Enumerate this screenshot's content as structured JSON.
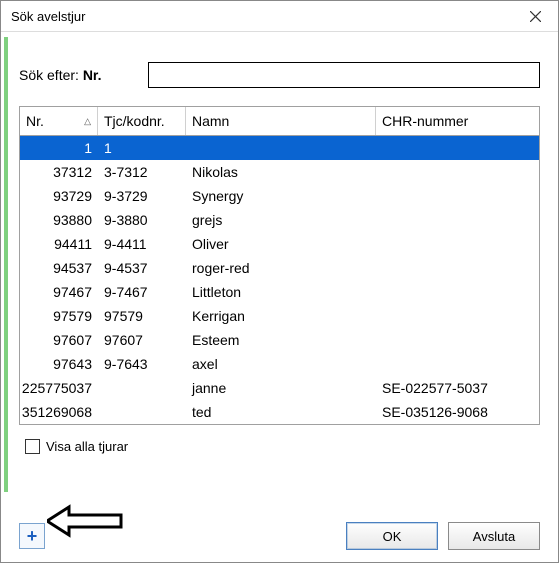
{
  "window": {
    "title": "Sök avelstjur"
  },
  "search": {
    "label_prefix": "Sök efter:",
    "label_field": "Nr.",
    "value": "",
    "placeholder": ""
  },
  "columns": [
    {
      "label": "Nr.",
      "sort": "asc"
    },
    {
      "label": "Tjc/kodnr."
    },
    {
      "label": "Namn"
    },
    {
      "label": "CHR-nummer"
    }
  ],
  "rows": [
    {
      "nr": "1",
      "kod": "1",
      "namn": "",
      "chr": "",
      "selected": true
    },
    {
      "nr": "37312",
      "kod": "3-7312",
      "namn": "Nikolas",
      "chr": ""
    },
    {
      "nr": "93729",
      "kod": "9-3729",
      "namn": "Synergy",
      "chr": ""
    },
    {
      "nr": "93880",
      "kod": "9-3880",
      "namn": "grejs",
      "chr": ""
    },
    {
      "nr": "94411",
      "kod": "9-4411",
      "namn": "Oliver",
      "chr": ""
    },
    {
      "nr": "94537",
      "kod": "9-4537",
      "namn": "roger-red",
      "chr": ""
    },
    {
      "nr": "97467",
      "kod": "9-7467",
      "namn": "Littleton",
      "chr": ""
    },
    {
      "nr": "97579",
      "kod": "97579",
      "namn": "Kerrigan",
      "chr": ""
    },
    {
      "nr": "97607",
      "kod": "97607",
      "namn": "Esteem",
      "chr": ""
    },
    {
      "nr": "97643",
      "kod": "9-7643",
      "namn": "axel",
      "chr": ""
    },
    {
      "nr": "225775037",
      "kod": "",
      "namn": "janne",
      "chr": "SE-022577-5037"
    },
    {
      "nr": "351269068",
      "kod": "",
      "namn": "ted",
      "chr": "SE-035126-9068"
    }
  ],
  "checkbox": {
    "label": "Visa alla tjurar",
    "checked": false
  },
  "buttons": {
    "add": "+",
    "ok": "OK",
    "cancel": "Avsluta"
  }
}
